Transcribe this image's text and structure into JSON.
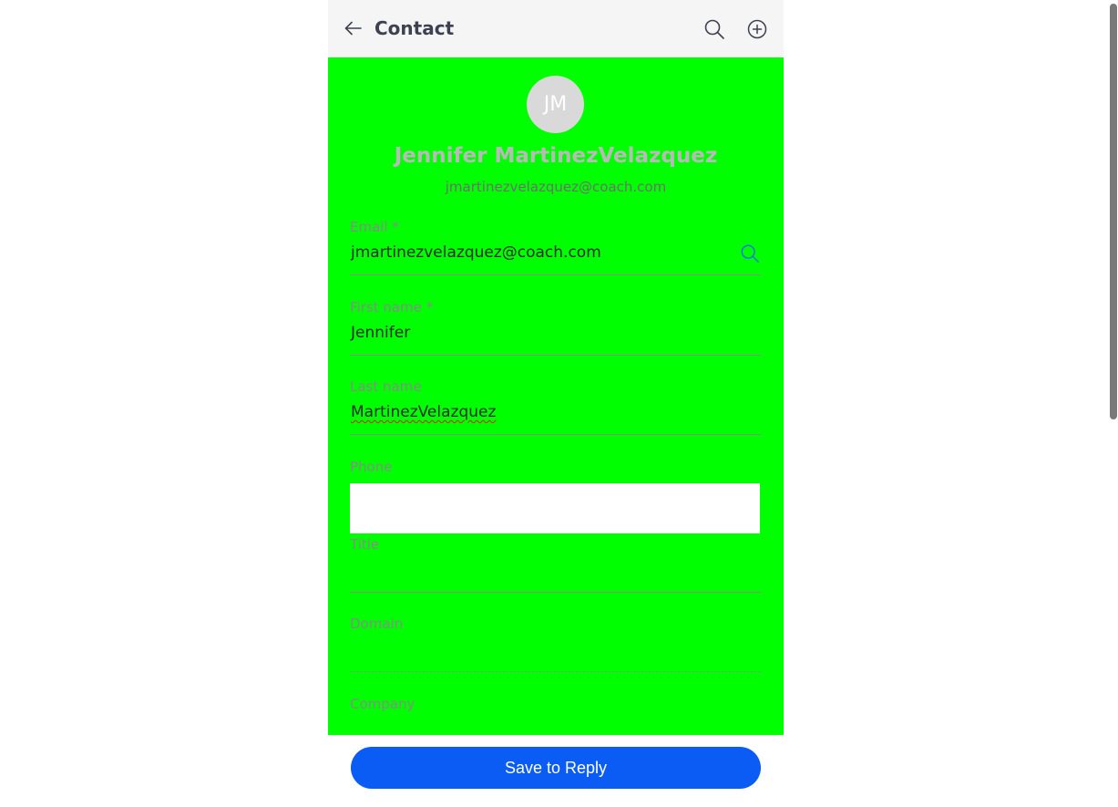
{
  "header": {
    "title": "Contact",
    "back_icon": "arrow-left-icon",
    "search_icon": "search-icon",
    "add_icon": "plus-circle-icon"
  },
  "profile": {
    "initials": "JM",
    "name": "Jennifer MartinezVelazquez",
    "email": "jmartinezvelazquez@coach.com"
  },
  "fields": {
    "email": {
      "label": "Email *",
      "value": "jmartinezvelazquez@coach.com"
    },
    "first_name": {
      "label": "First name *",
      "value": "Jennifer"
    },
    "last_name": {
      "label": "Last name",
      "value": "MartinezVelazquez"
    },
    "phone": {
      "label": "Phone",
      "value": ""
    },
    "title": {
      "label": "Title",
      "value": ""
    },
    "domain": {
      "label": "Domain",
      "value": ""
    },
    "company": {
      "label": "Company",
      "value": ""
    }
  },
  "footer": {
    "save_label": "Save to Reply"
  },
  "colors": {
    "form_background": "#00ff00",
    "primary_button": "#0a5cf5",
    "search_accent": "#1a73e8"
  }
}
